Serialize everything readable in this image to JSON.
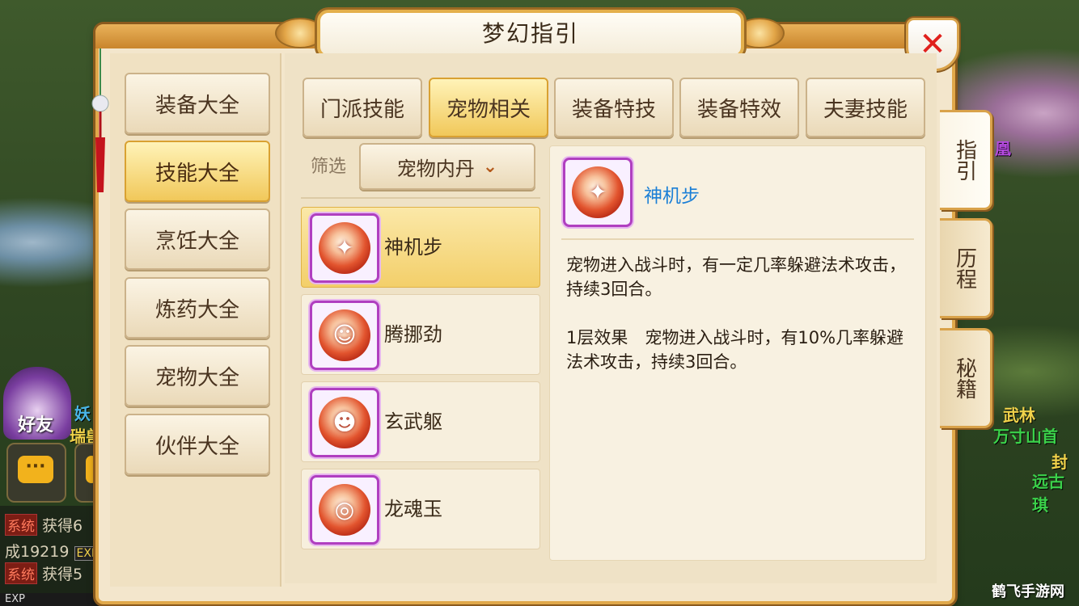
{
  "dialog": {
    "title": "梦幻指引",
    "close_label": "✕"
  },
  "left_menu": {
    "items": [
      {
        "label": "装备大全",
        "active": false
      },
      {
        "label": "技能大全",
        "active": true
      },
      {
        "label": "烹饪大全",
        "active": false
      },
      {
        "label": "炼药大全",
        "active": false
      },
      {
        "label": "宠物大全",
        "active": false
      },
      {
        "label": "伙伴大全",
        "active": false
      }
    ]
  },
  "tabs": {
    "items": [
      {
        "label": "门派技能",
        "active": false
      },
      {
        "label": "宠物相关",
        "active": true
      },
      {
        "label": "装备特技",
        "active": false
      },
      {
        "label": "装备特效",
        "active": false
      },
      {
        "label": "夫妻技能",
        "active": false
      }
    ]
  },
  "filter": {
    "label": "筛选",
    "selected": "宠物内丹"
  },
  "skill_list": {
    "items": [
      {
        "name": "神机步",
        "active": true
      },
      {
        "name": "腾挪劲",
        "active": false
      },
      {
        "name": "玄武躯",
        "active": false
      },
      {
        "name": "龙魂玉",
        "active": false
      }
    ]
  },
  "detail": {
    "name": "神机步",
    "description": "宠物进入战斗时，有一定几率躲避法术攻击，持续3回合。",
    "level_effect": "1层效果　宠物进入战斗时，有10%几率躲避法术攻击，持续3回合。"
  },
  "side_tabs": {
    "items": [
      {
        "label": "指引",
        "active": true
      },
      {
        "label": "历程",
        "active": false
      },
      {
        "label": "秘籍",
        "active": false
      }
    ]
  },
  "background": {
    "friend_label": "好友",
    "chat": {
      "sys_tag": "系统",
      "line1_text": "获得6",
      "line2_text": "成19219",
      "exp_tag": "EXP",
      "line3_text": "获得5",
      "bottom_exp": "EXP"
    },
    "right_texts": [
      "凰",
      "武林",
      "万寸山首",
      "封",
      "远古琪"
    ],
    "left_texts": [
      "妖",
      "瑞兽"
    ]
  },
  "watermark": "鹤飞手游网"
}
